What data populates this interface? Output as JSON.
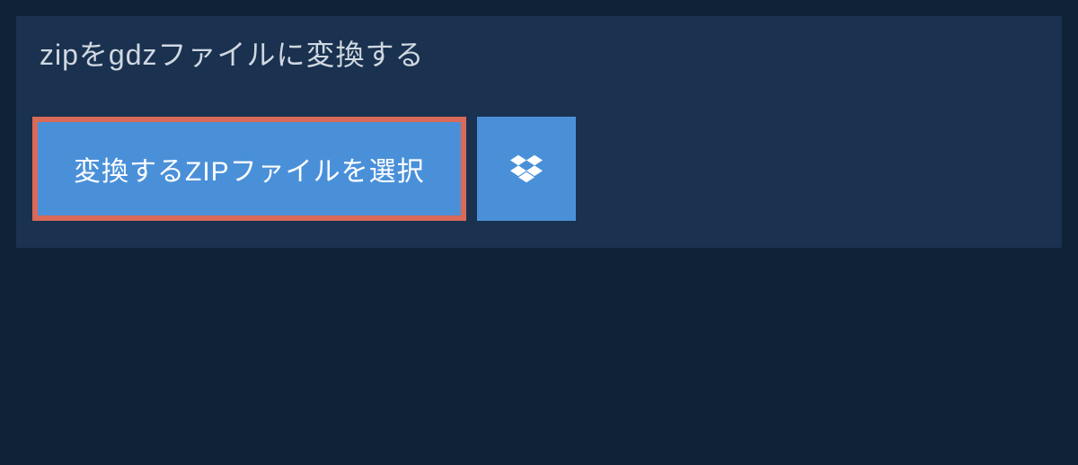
{
  "header": {
    "title": "zipをgdzファイルに変換する"
  },
  "buttons": {
    "select_file_label": "変換するZIPファイルを選択",
    "dropbox_icon_name": "dropbox-icon"
  },
  "colors": {
    "page_bg": "#0f2238",
    "panel_bg": "#1a3150",
    "button_bg": "#4a90d9",
    "button_border": "#d96a5a",
    "text_light": "#d0d8e0",
    "text_white": "#ffffff"
  }
}
